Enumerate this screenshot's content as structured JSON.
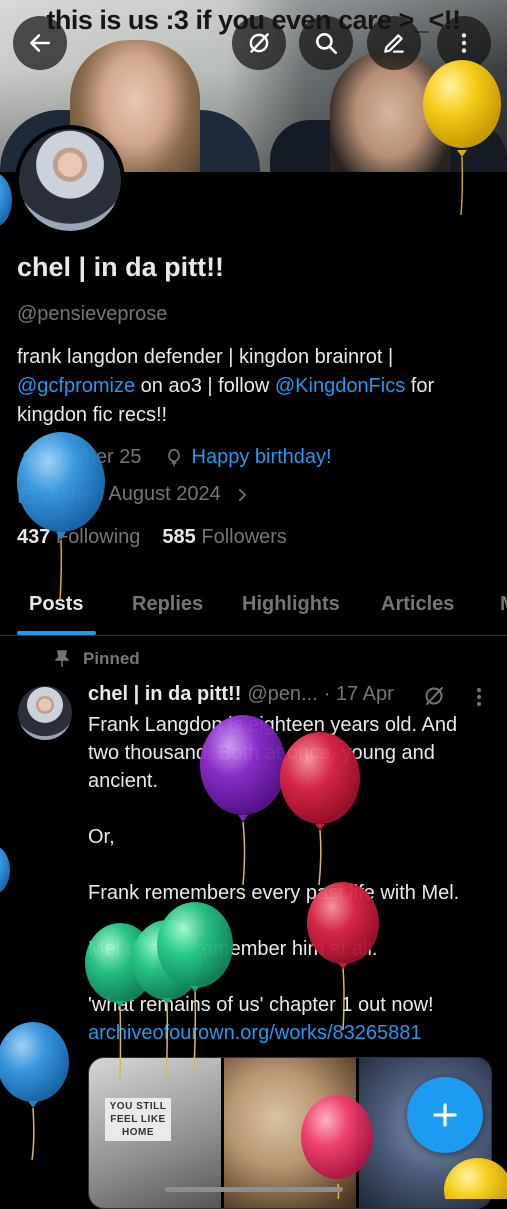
{
  "banner": {
    "caption": "this is us :3 if you even care >_<!!"
  },
  "toolbar": {
    "back_icon": "arrow-left-icon",
    "grok_icon": "slash-circle-icon",
    "search_icon": "search-icon",
    "edit_icon": "pencil-icon",
    "more_icon": "more-vertical-icon"
  },
  "profile": {
    "display_name": "chel | in da pitt!!",
    "handle": "@pensieveprose",
    "bio": {
      "part1": "frank langdon defender | kingdon brainrot | ",
      "mention1": "@gcfpromize",
      "part2": " on ao3 | follow ",
      "mention2": "@KingdonFics",
      "part3": " for kingdon fic recs!!"
    },
    "pronouns": "she/her 25",
    "birthday": "Happy birthday!",
    "joined": "Joined August 2024",
    "following_count": "437",
    "following_label": "Following",
    "followers_count": "585",
    "followers_label": "Followers"
  },
  "tabs": [
    "Posts",
    "Replies",
    "Highlights",
    "Articles"
  ],
  "active_tab": "Posts",
  "pinned_label": "Pinned",
  "tweet": {
    "name": "chel | in da pitt!!",
    "handle": "@pen...",
    "date": "· 17 Apr",
    "paragraphs": [
      "Frank Langdon is eighteen years old. And two thousand. Both at once, young and ancient.",
      "Or,",
      "Frank remembers every past life with Mel.",
      "Mel doesn't remember him at all.",
      "'what remains of us' chapter 1 out now!"
    ],
    "link": "archiveofourown.org/works/83265881",
    "media_sign": "YOU STILL FEEL LIKE HOME"
  },
  "fab": {
    "icon": "plus-icon"
  },
  "colors": {
    "accent": "#1d9bf0",
    "bg": "#000000",
    "muted": "#71767b",
    "text": "#e7e9ea"
  },
  "balloons": [
    "yellow",
    "blue",
    "blue",
    "purple",
    "red",
    "red",
    "green",
    "green",
    "green",
    "blue",
    "pink",
    "yellow"
  ]
}
